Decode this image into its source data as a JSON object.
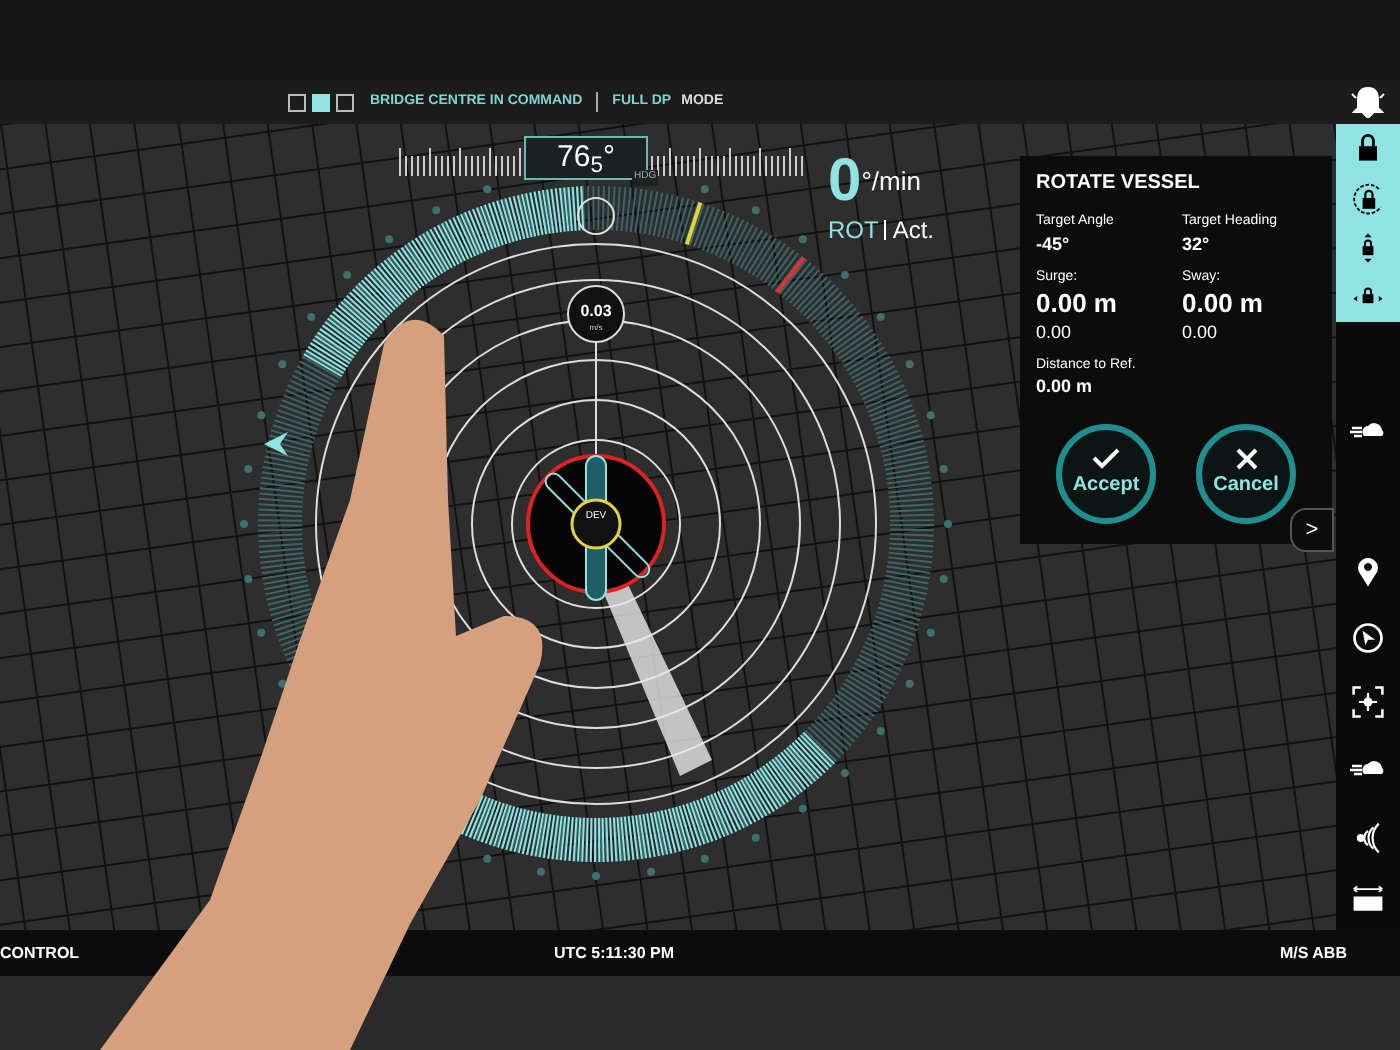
{
  "mode_indicators": [
    {
      "selected": false
    },
    {
      "selected": true
    },
    {
      "selected": false
    }
  ],
  "header": {
    "command": "BRIDGE CENTRE IN COMMAND",
    "dp": "FULL DP",
    "mode": "MODE"
  },
  "heading": {
    "value": "76$_{5}$°",
    "label": "HDG"
  },
  "rot": {
    "value": "0",
    "unit": "°/min",
    "label": "ROT",
    "mode": "Act."
  },
  "speed": {
    "value": "0.03",
    "unit": "m/s"
  },
  "centre_label": "DEV",
  "panel": {
    "title": "ROTATE VESSEL",
    "fields": [
      {
        "label": "Target Angle",
        "value": "-45°",
        "kind": "small"
      },
      {
        "label": "Target Heading",
        "value": "32°",
        "kind": "small"
      },
      {
        "label": "Surge:",
        "value": "0.00 m",
        "sub": "0.00",
        "kind": "large"
      },
      {
        "label": "Sway:",
        "value": "0.00 m",
        "sub": "0.00",
        "kind": "large"
      },
      {
        "label": "Distance to Ref.",
        "value": "0.00 m",
        "kind": "small"
      }
    ],
    "buttons": [
      {
        "kind": "accept",
        "label": "Accept"
      },
      {
        "kind": "cancel",
        "label": "Cancel"
      }
    ],
    "expand": ">"
  },
  "sidebar": [
    {
      "kind": "lock",
      "selected": true
    },
    {
      "kind": "rotate-lock",
      "selected": true
    },
    {
      "kind": "vertical-lock",
      "selected": true
    },
    {
      "kind": "horizontal-lock",
      "selected": true
    },
    {
      "kind": "wind",
      "selected": false
    },
    {
      "kind": "pin",
      "selected": false
    },
    {
      "kind": "pointer",
      "selected": false
    },
    {
      "kind": "target",
      "selected": false
    },
    {
      "kind": "wind",
      "selected": false
    },
    {
      "kind": "signal",
      "selected": false
    },
    {
      "kind": "ruler",
      "selected": false
    }
  ],
  "status_bar": {
    "left": "CONTROL",
    "centre": "UTC 5:11:30 PM",
    "right": "M/S ABB"
  }
}
